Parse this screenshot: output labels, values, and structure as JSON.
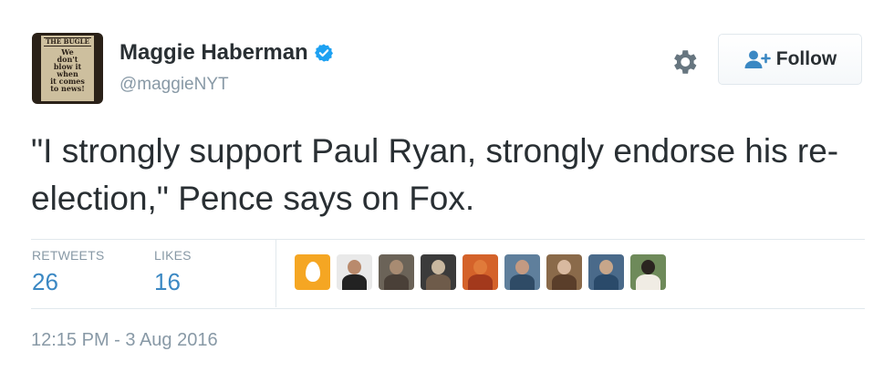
{
  "author": {
    "name": "Maggie Haberman",
    "handle": "@maggieNYT",
    "verified": true,
    "avatar_text": {
      "masthead": "THE BUGLE",
      "lines": [
        "We",
        "don't",
        "blow it",
        "when",
        "it comes",
        "to news!"
      ]
    }
  },
  "header": {
    "gear_icon": "gear-icon",
    "follow_label": "Follow",
    "follow_icon": "follow-person-plus-icon"
  },
  "tweet": {
    "text": "\"I strongly support Paul Ryan, strongly endorse his re-election,\" Pence says on Fox."
  },
  "stats": {
    "retweets_label": "RETWEETS",
    "retweets_count": "26",
    "likes_label": "LIKES",
    "likes_count": "16"
  },
  "likers": [
    {
      "kind": "egg",
      "color": "#f5a623"
    },
    {
      "kind": "person",
      "color": "#e9e9e9",
      "head": "#b98a6c",
      "body": "#222222"
    },
    {
      "kind": "person",
      "color": "#6b6358",
      "head": "#a88b72",
      "body": "#4a4038"
    },
    {
      "kind": "person",
      "color": "#3b3b3b",
      "head": "#c9b8a0",
      "body": "#6e5b4a"
    },
    {
      "kind": "person",
      "color": "#d4622a",
      "head": "#e07a3a",
      "body": "#a3391c"
    },
    {
      "kind": "person",
      "color": "#5f7f9c",
      "head": "#c49a82",
      "body": "#2f4b66"
    },
    {
      "kind": "person",
      "color": "#8a6a4a",
      "head": "#d8b9a0",
      "body": "#5a3e2a"
    },
    {
      "kind": "person",
      "color": "#4a6a8a",
      "head": "#c7a68a",
      "body": "#2a4a6a"
    },
    {
      "kind": "dog",
      "color": "#6e8a5a",
      "head": "#2a2420",
      "body": "#f0ece4"
    }
  ],
  "timestamp": "12:15 PM - 3 Aug 2016",
  "colors": {
    "link_blue": "#3b88c3",
    "muted": "#8899a6",
    "text": "#292f33",
    "verified_blue": "#1da1f2",
    "border": "#e1e8ed"
  }
}
